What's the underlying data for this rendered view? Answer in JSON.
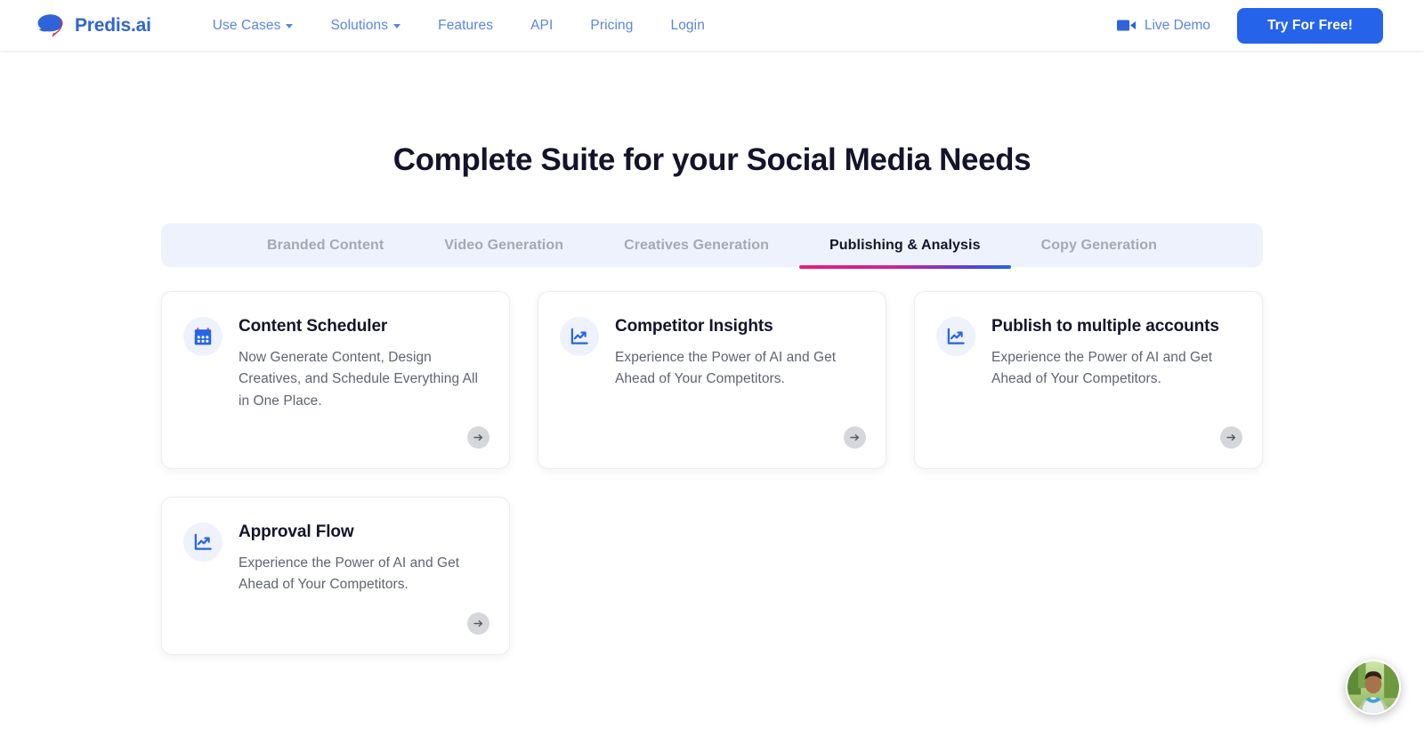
{
  "header": {
    "brand": {
      "name": "Predis.ai",
      "logo_icon": "speech-bubble-logo"
    },
    "nav_links": [
      {
        "label": "Use Cases",
        "has_dropdown": true
      },
      {
        "label": "Solutions",
        "has_dropdown": true
      },
      {
        "label": "Features",
        "has_dropdown": false
      },
      {
        "label": "API",
        "has_dropdown": false
      },
      {
        "label": "Pricing",
        "has_dropdown": false
      },
      {
        "label": "Login",
        "has_dropdown": false
      }
    ],
    "live_demo": {
      "label": "Live Demo",
      "icon": "video-camera-icon"
    },
    "cta": {
      "label": "Try For Free!",
      "color": "#2563eb"
    }
  },
  "main": {
    "title": "Complete Suite for your Social Media Needs",
    "tabs": [
      {
        "label": "Branded Content",
        "active": false
      },
      {
        "label": "Video Generation",
        "active": false
      },
      {
        "label": "Creatives Generation",
        "active": false
      },
      {
        "label": "Publishing & Analysis",
        "active": true
      },
      {
        "label": "Copy Generation",
        "active": false
      }
    ],
    "tab_underline_gradient": [
      "#ec1a7e",
      "#2563eb"
    ],
    "cards": [
      {
        "title": "Content Scheduler",
        "description": "Now Generate Content, Design Creatives, and Schedule Everything All in One Place.",
        "icon": "calendar-icon",
        "arrow_label": "arrow-right-icon"
      },
      {
        "title": "Competitor Insights",
        "description": "Experience the Power of AI and Get Ahead of Your Competitors.",
        "icon": "line-chart-trending-up-icon",
        "arrow_label": "arrow-right-icon"
      },
      {
        "title": "Publish to multiple accounts",
        "description": "Experience the Power of AI and Get Ahead of Your Competitors.",
        "icon": "line-chart-trending-up-icon",
        "arrow_label": "arrow-right-icon"
      },
      {
        "title": "Approval Flow",
        "description": "Experience the Power of AI and Get Ahead of Your Competitors.",
        "icon": "line-chart-trending-up-icon",
        "arrow_label": "arrow-right-icon"
      }
    ]
  },
  "floating_widget": {
    "icon": "user-avatar-photo"
  }
}
